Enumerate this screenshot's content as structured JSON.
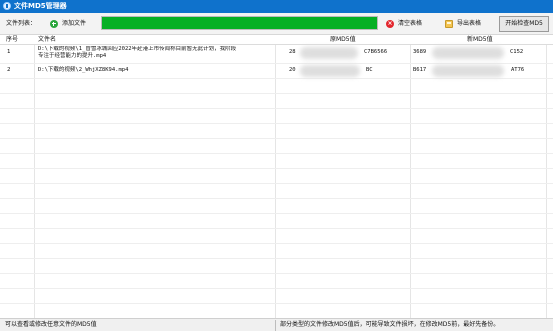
{
  "window": {
    "title": "文件MD5管理器"
  },
  "toolbar": {
    "file_list_label": "文件列表：",
    "add_file_label": "添加文件",
    "progress_fraction": 1.0,
    "clear_table_label": "清空表格",
    "export_table_label": "导出表格",
    "start_check_label": "开始检查MD5"
  },
  "table": {
    "headers": {
      "seq": "序号",
      "name": "文件名",
      "orig_md5": "原MD5值",
      "new_md5": "新MD5值"
    },
    "rows": [
      {
        "seq": "1",
        "name_line1": "D:\\下载的视频\\1_冒雪冰城回应2022年赴港上市传闻称目前暂无此计划，我阶段",
        "name_line2": "专注于经营能力的提升.mp4",
        "orig_md5_head": "28",
        "orig_md5_tail": "C7B6566",
        "new_md5_head": "3689",
        "new_md5_tail": "C152"
      },
      {
        "seq": "2",
        "name_line1": "D:\\下载的视频\\2_WhjXZ8K94.mp4",
        "name_line2": "",
        "orig_md5_head": "20",
        "orig_md5_tail": "BC",
        "new_md5_head": "B617",
        "new_md5_tail": "AT76"
      }
    ]
  },
  "status": {
    "left": "可以查看或修改任意文件的MD5值",
    "right": "部分类型的文件修改MD5值后，可能导致文件损坏，在修改MD5前，最好先备份。"
  },
  "colors": {
    "titlebar": "#0f72cc",
    "progress": "#06b025"
  }
}
